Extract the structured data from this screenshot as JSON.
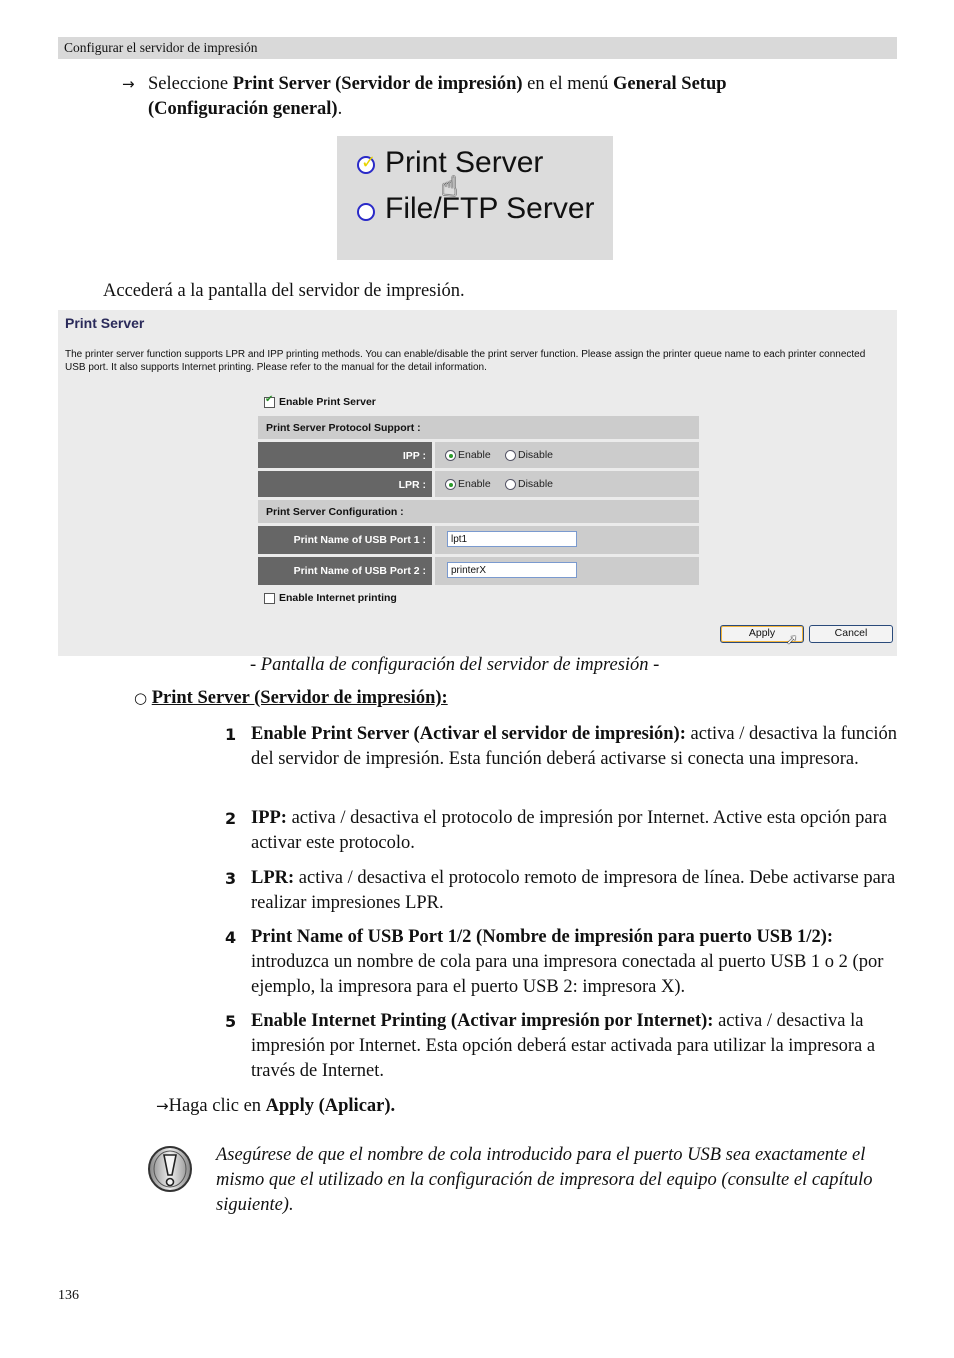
{
  "header": {
    "title": "Configurar el servidor de impresión"
  },
  "step1": {
    "arrow": "→",
    "prefix": "Seleccione ",
    "bold1": "Print Server (Servidor de impresión)",
    "middle": " en el menú ",
    "bold2a": "General Setup",
    "bold2b": "(Configuración general)",
    "suffix": "."
  },
  "menu_snippet": {
    "items": [
      {
        "label": "Print Server",
        "selected": true
      },
      {
        "label": "File/FTP Server",
        "selected": false
      }
    ]
  },
  "intro": "Accederá a la pantalla del servidor de impresión.",
  "panel": {
    "title": "Print Server",
    "description": "The printer server function supports LPR and IPP printing methods. You can enable/disable the print server function. Please assign the printer queue name to each printer connected USB port. It also supports Internet printing. Please refer to the manual for the detail information.",
    "enable_print_server": {
      "label": "Enable Print Server",
      "checked": true
    },
    "protocol_header": "Print Server Protocol Support :",
    "ipp": {
      "label": "IPP :",
      "enable": "Enable",
      "disable": "Disable",
      "value": "Enable"
    },
    "lpr": {
      "label": "LPR :",
      "enable": "Enable",
      "disable": "Disable",
      "value": "Enable"
    },
    "config_header": "Print Server Configuration :",
    "port1": {
      "label": "Print Name of USB Port 1 :",
      "value": "lpt1"
    },
    "port2": {
      "label": "Print Name of USB Port 2 :",
      "value": "printerX"
    },
    "enable_internet": {
      "label": "Enable Internet printing",
      "checked": false
    },
    "apply_label": "Apply",
    "cancel_label": "Cancel"
  },
  "caption": "- Pantalla de configuración del servidor de impresión -",
  "section": {
    "bullet": "○",
    "title": "Print Server (Servidor de impresión):"
  },
  "items": [
    {
      "num": "1",
      "bold": "Enable Print Server (Activar el servidor de impresión):",
      "text": " activa / desactiva la función del servidor de impresión. Esta función deberá activarse si conecta una impresora."
    },
    {
      "num": "2",
      "bold": "IPP:",
      "text": " activa / desactiva el protocolo de impresión por Internet. Active esta opción para activar este protocolo."
    },
    {
      "num": "3",
      "bold": "LPR:",
      "text": " activa / desactiva el protocolo remoto de impresora de línea. Debe activarse para realizar impresiones LPR."
    },
    {
      "num": "4",
      "bold": "Print Name of USB Port 1/2 (Nombre de impresión para puerto USB 1/2):",
      "text": " introduzca un nombre de cola para una impresora conectada al puerto USB 1 o 2 (por ejemplo, la impresora para el puerto USB 2: impresora X)."
    },
    {
      "num": "5",
      "bold": "Enable Internet Printing (Activar impresión por Internet):",
      "text": " activa / desactiva la impresión por Internet. Esta opción deberá estar activada para utilizar la impresora a través de Internet."
    }
  ],
  "final_step": {
    "arrow": "→",
    "prefix": "Haga clic en ",
    "bold": "Apply (Aplicar)."
  },
  "warning": {
    "icon": "warning-exclamation-icon",
    "text": "Asegúrese de que el nombre de cola introducido para el puerto USB sea exactamente el mismo que el utilizado en la configuración de impresora del equipo (consulte el capítulo siguiente)."
  },
  "page_number": "136"
}
